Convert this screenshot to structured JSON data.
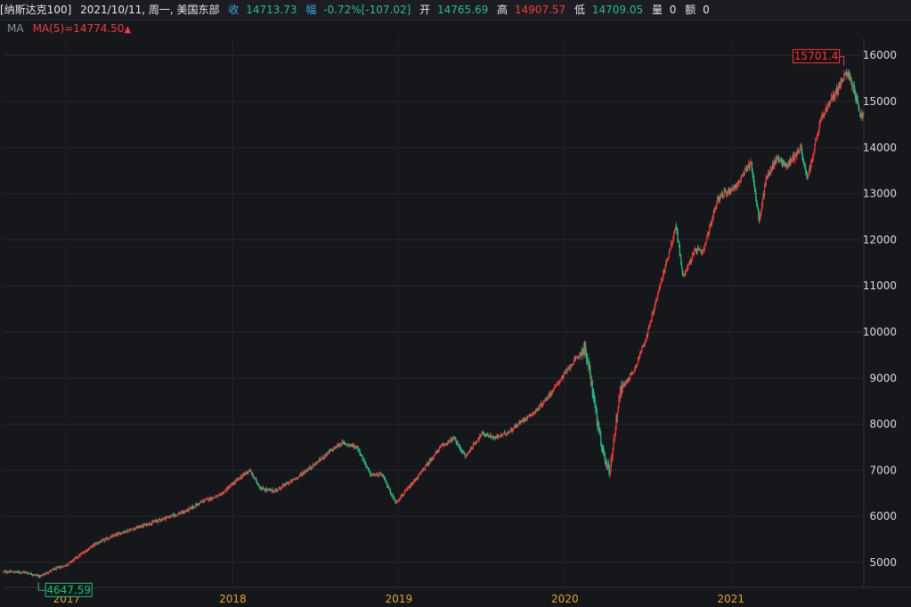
{
  "header": {
    "symbol": "[纳斯达克100]",
    "date": "2021/10/11, 周一, 美国东部",
    "close_label": "收",
    "close": "14713.73",
    "change_label": "幅",
    "change_pct": "-0.72%",
    "change_abs": "[-107.02]",
    "open_label": "开",
    "open": "14765.69",
    "high_label": "高",
    "high": "14907.57",
    "low_label": "低",
    "low": "14709.05",
    "volume_label": "量",
    "volume": "0",
    "amount_label": "额",
    "amount": "0"
  },
  "ma": {
    "label": "MA",
    "value": "MA(5)=14774.50"
  },
  "colors": {
    "up": "#f03b3b",
    "down": "#2dbb86",
    "grid": "#262830",
    "axis_text": "#d8dbe2",
    "year_text": "#e2a23a"
  },
  "chart_data": {
    "type": "candlestick",
    "y_ticks": [
      5000,
      6000,
      7000,
      8000,
      9000,
      10000,
      11000,
      12000,
      13000,
      14000,
      15000,
      16000
    ],
    "x_year_labels": [
      {
        "label": "2017",
        "date": "2017.0"
      },
      {
        "label": "2018",
        "date": "2018.0"
      },
      {
        "label": "2019",
        "date": "2019.0"
      },
      {
        "label": "2020",
        "date": "2020.0"
      },
      {
        "label": "2021",
        "date": "2021.0"
      }
    ],
    "high_marker": {
      "label": "15701.4",
      "value": 15701.4,
      "date": "2021.68"
    },
    "low_marker": {
      "label": "4647.59",
      "value": 4647.59,
      "date": "2016.83"
    },
    "path_dates": [
      2016.62,
      2016.75,
      2016.84,
      2016.92,
      2017.0,
      2017.17,
      2017.33,
      2017.46,
      2017.58,
      2017.71,
      2017.83,
      2017.92,
      2018.03,
      2018.1,
      2018.17,
      2018.25,
      2018.37,
      2018.5,
      2018.58,
      2018.66,
      2018.75,
      2018.83,
      2018.9,
      2018.98,
      2019.08,
      2019.25,
      2019.33,
      2019.4,
      2019.5,
      2019.58,
      2019.67,
      2019.75,
      2019.83,
      2019.92,
      2020.04,
      2020.12,
      2020.16,
      2020.22,
      2020.27,
      2020.33,
      2020.42,
      2020.5,
      2020.58,
      2020.67,
      2020.71,
      2020.79,
      2020.83,
      2020.92,
      2021.04,
      2021.12,
      2021.17,
      2021.21,
      2021.28,
      2021.33,
      2021.38,
      2021.42,
      2021.46,
      2021.54,
      2021.63,
      2021.7,
      2021.74,
      2021.78,
      2021.8
    ],
    "path_values": [
      4800,
      4790,
      4700,
      4850,
      4950,
      5400,
      5650,
      5800,
      5950,
      6100,
      6350,
      6450,
      6800,
      7000,
      6600,
      6550,
      6800,
      7150,
      7400,
      7600,
      7500,
      6900,
      6900,
      6300,
      6700,
      7500,
      7700,
      7300,
      7800,
      7700,
      7850,
      8100,
      8300,
      8700,
      9300,
      9650,
      8900,
      7500,
      6950,
      8700,
      9200,
      10000,
      11100,
      12300,
      11200,
      11800,
      11700,
      12900,
      13200,
      13700,
      12400,
      13300,
      13800,
      13600,
      13800,
      14000,
      13300,
      14600,
      15200,
      15650,
      15300,
      14700,
      14714
    ]
  }
}
